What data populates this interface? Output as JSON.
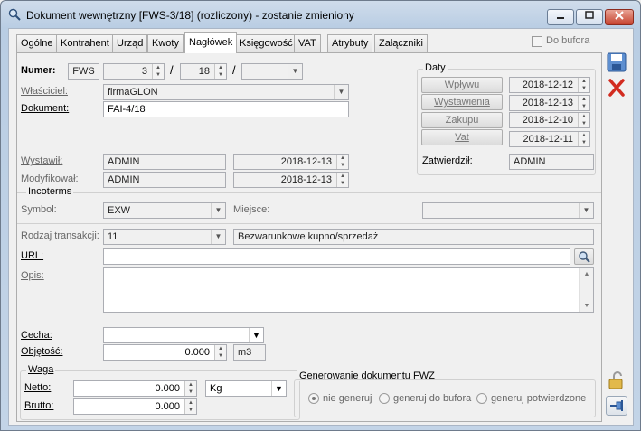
{
  "window": {
    "title": "Dokument wewnętrzny [FWS-3/18] (rozliczony) - zostanie zmieniony"
  },
  "tabs": [
    {
      "label": "Ogólne"
    },
    {
      "label": "Kontrahent"
    },
    {
      "label": "Urząd"
    },
    {
      "label": "Kwoty"
    },
    {
      "label": "Nagłówek"
    },
    {
      "label": "Księgowość"
    },
    {
      "label": "VAT"
    },
    {
      "label": "Atrybuty"
    },
    {
      "label": "Załączniki"
    }
  ],
  "active_tab": "Nagłówek",
  "do_bufora": {
    "label": "Do bufora",
    "checked": false
  },
  "numer": {
    "label": "Numer:",
    "prefix": "FWS",
    "number": "3",
    "sep1": "/",
    "year": "18",
    "sep2": "/",
    "series": ""
  },
  "daty": {
    "title": "Daty",
    "wplywu_label": "Wpływu",
    "wplywu_value": "2018-12-12",
    "wystawienia_label": "Wystawienia",
    "wystawienia_value": "2018-12-13",
    "zakupu_label": "Zakupu",
    "zakupu_value": "2018-12-10",
    "vat_label": "Vat",
    "vat_value": "2018-12-11"
  },
  "wlasciciel": {
    "label": "Właściciel:",
    "value": "firmaGLON"
  },
  "dokument": {
    "label": "Dokument:",
    "value": "FAI-4/18"
  },
  "wystawil": {
    "label": "Wystawił:",
    "user": "ADMIN",
    "date": "2018-12-13"
  },
  "modyfikowal": {
    "label": "Modyfikował:",
    "user": "ADMIN",
    "date": "2018-12-13"
  },
  "zatwierdzil": {
    "label": "Zatwierdził:",
    "value": "ADMIN"
  },
  "incoterms": {
    "title": "Incoterms",
    "symbol_label": "Symbol:",
    "symbol_value": "EXW",
    "miejsce_label": "Miejsce:",
    "miejsce_value": ""
  },
  "rodzaj_transakcji": {
    "label": "Rodzaj transakcji:",
    "code": "11",
    "description": "Bezwarunkowe kupno/sprzedaż"
  },
  "url": {
    "label": "URL:",
    "value": ""
  },
  "opis": {
    "label": "Opis:",
    "value": ""
  },
  "cecha": {
    "label": "Cecha:",
    "value": ""
  },
  "objetosc": {
    "label": "Objętość:",
    "value": "0.000",
    "unit": "m3"
  },
  "waga": {
    "title": "Waga",
    "netto_label": "Netto:",
    "netto_value": "0.000",
    "unit": "Kg",
    "brutto_label": "Brutto:",
    "brutto_value": "0.000"
  },
  "fwz": {
    "title": "Generowanie dokumentu FWZ",
    "options": [
      {
        "label": "nie generuj",
        "selected": true
      },
      {
        "label": "generuj do bufora",
        "selected": false
      },
      {
        "label": "generuj potwierdzone",
        "selected": false
      }
    ]
  },
  "side_icons": [
    "save-icon",
    "cancel-icon",
    "unlock-icon",
    "pin-icon"
  ],
  "colors": {
    "accent": "#3a6fb8",
    "cancel": "#d22b1f"
  }
}
